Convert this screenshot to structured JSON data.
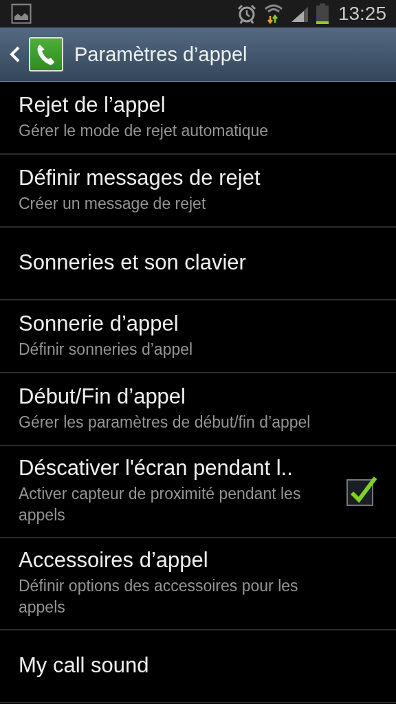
{
  "status_bar": {
    "time": "13:25"
  },
  "header": {
    "title": "Paramètres d’appel"
  },
  "items": [
    {
      "kind": "item",
      "title": "Rejet de l’appel",
      "subtitle": "Gérer le mode de rejet automatique"
    },
    {
      "kind": "item",
      "title": "Définir messages de rejet",
      "subtitle": "Créer un message de rejet"
    },
    {
      "kind": "item",
      "title": "Sonneries et son clavier"
    },
    {
      "kind": "item",
      "title": "Sonnerie d’appel",
      "subtitle": "Définir sonneries d’appel"
    },
    {
      "kind": "item",
      "title": "Début/Fin d’appel",
      "subtitle": "Gérer les paramètres de début/fin d’appel"
    },
    {
      "kind": "checkbox",
      "title": "Déscativer l'écran pendant l..",
      "subtitle": "Activer capteur de proximité pendant les appels",
      "checked": true
    },
    {
      "kind": "item",
      "title": "Accessoires d’appel",
      "subtitle": "Définir options des accessoires pour les appels"
    },
    {
      "kind": "item",
      "title": "My call sound"
    }
  ]
}
